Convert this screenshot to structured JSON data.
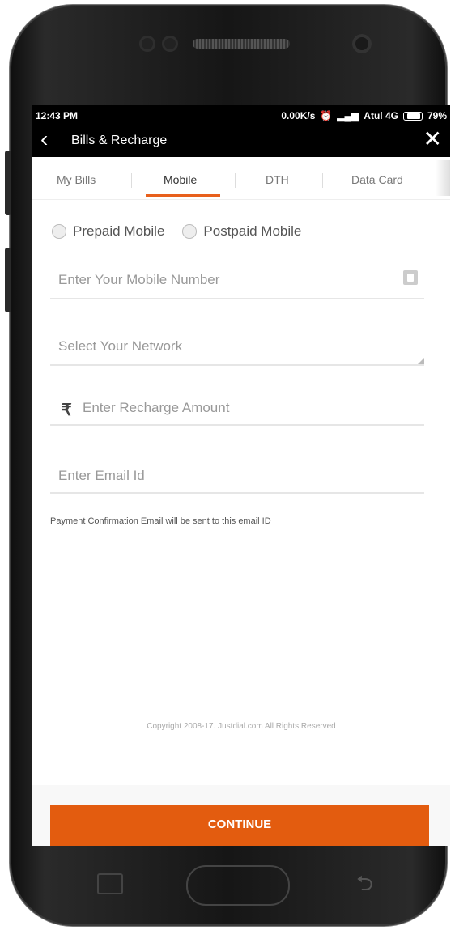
{
  "status_bar": {
    "time": "12:43 PM",
    "network_speed": "0.00K/s",
    "carrier": "Atul 4G",
    "battery": "79%"
  },
  "app_bar": {
    "back_icon": "chevron-left-icon",
    "title": "Bills & Recharge",
    "close_icon": "close-icon"
  },
  "tabs": [
    {
      "label": "My Bills"
    },
    {
      "label": "Mobile"
    },
    {
      "label": "DTH"
    },
    {
      "label": "Data Card"
    }
  ],
  "form": {
    "plan_options": [
      {
        "label": "Prepaid Mobile"
      },
      {
        "label": "Postpaid Mobile"
      }
    ],
    "mobile_placeholder": "Enter Your Mobile Number",
    "network_placeholder": "Select Your Network",
    "currency_symbol": "₹",
    "amount_placeholder": "Enter Recharge Amount",
    "email_placeholder": "Enter Email Id",
    "helper_text": "Payment Confirmation Email will be sent to this email ID"
  },
  "footer": {
    "copyright": "Copyright 2008-17. Justdial.com All Rights Reserved"
  },
  "continue_label": "CONTINUE",
  "colors": {
    "accent": "#e8601c",
    "button": "#e35c0f"
  }
}
